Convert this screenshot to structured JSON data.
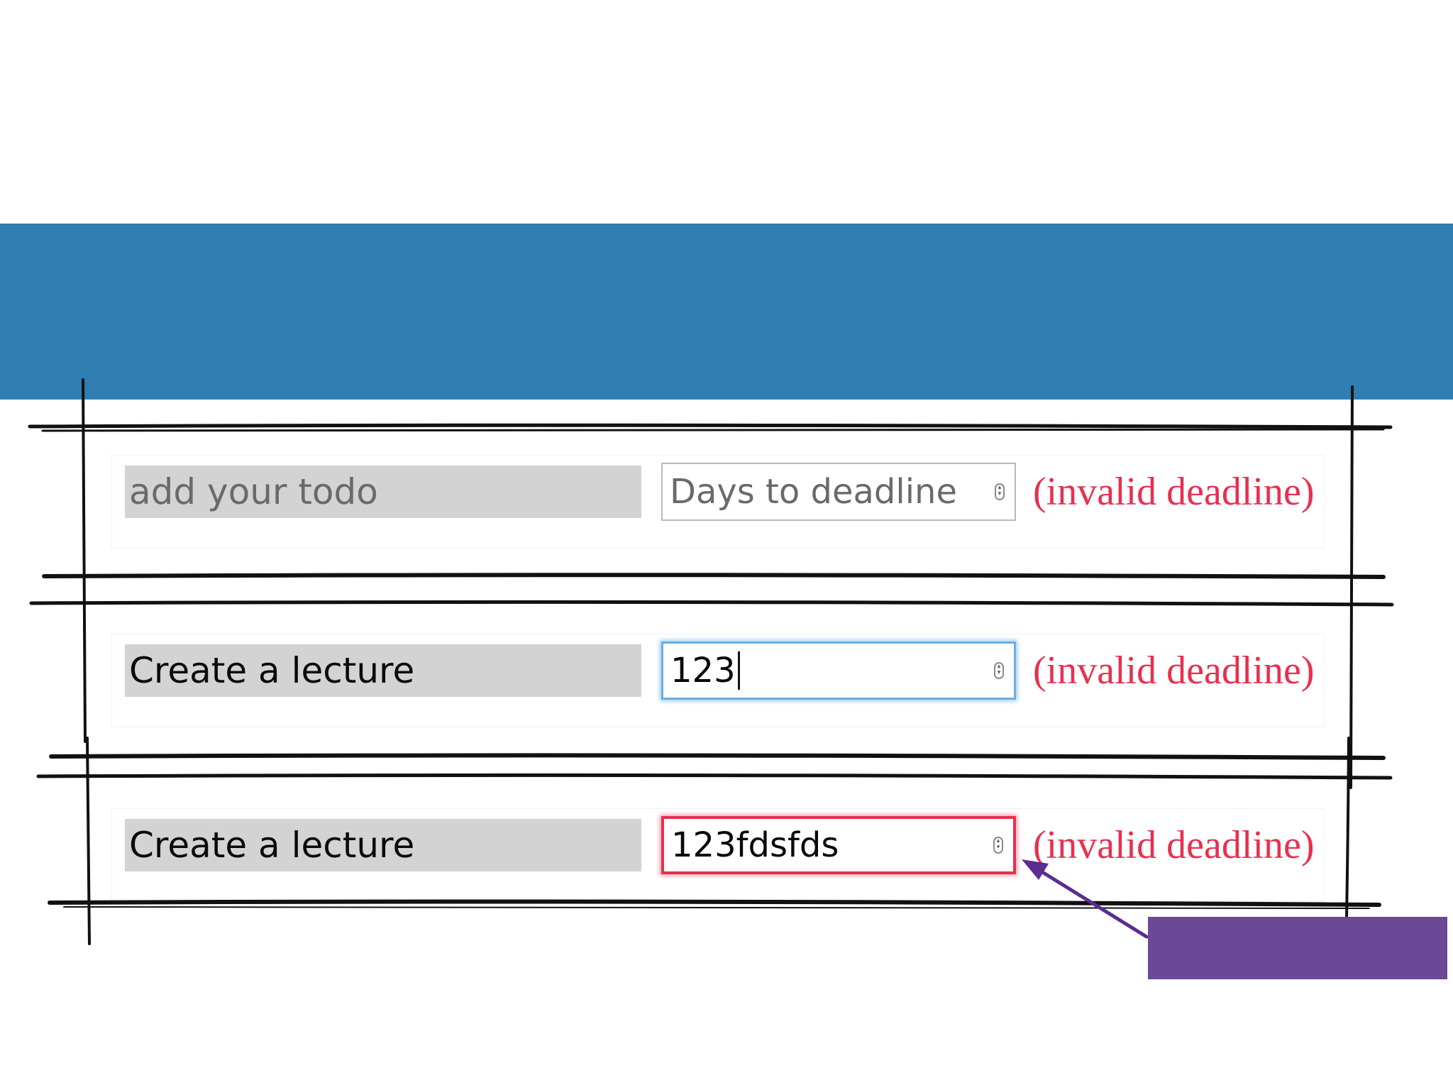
{
  "rows": [
    {
      "todo_placeholder": "add your todo",
      "deadline_placeholder": "Days to deadline",
      "error": "(invalid deadline)"
    },
    {
      "todo_value": "Create a lecture",
      "deadline_value": "123",
      "error": "(invalid deadline)"
    },
    {
      "todo_value": "Create a lecture",
      "deadline_value": "123fdsfds",
      "error": "(invalid deadline)"
    }
  ],
  "colors": {
    "banner": "#2e7eb1",
    "error_text": "#e8304f",
    "focus_border": "#6aaee0",
    "invalid_border": "#e8304f",
    "callout": "#6d4896",
    "arrow": "#5a2d91"
  },
  "icons": [
    "spinner-icon",
    "arrow-icon"
  ]
}
